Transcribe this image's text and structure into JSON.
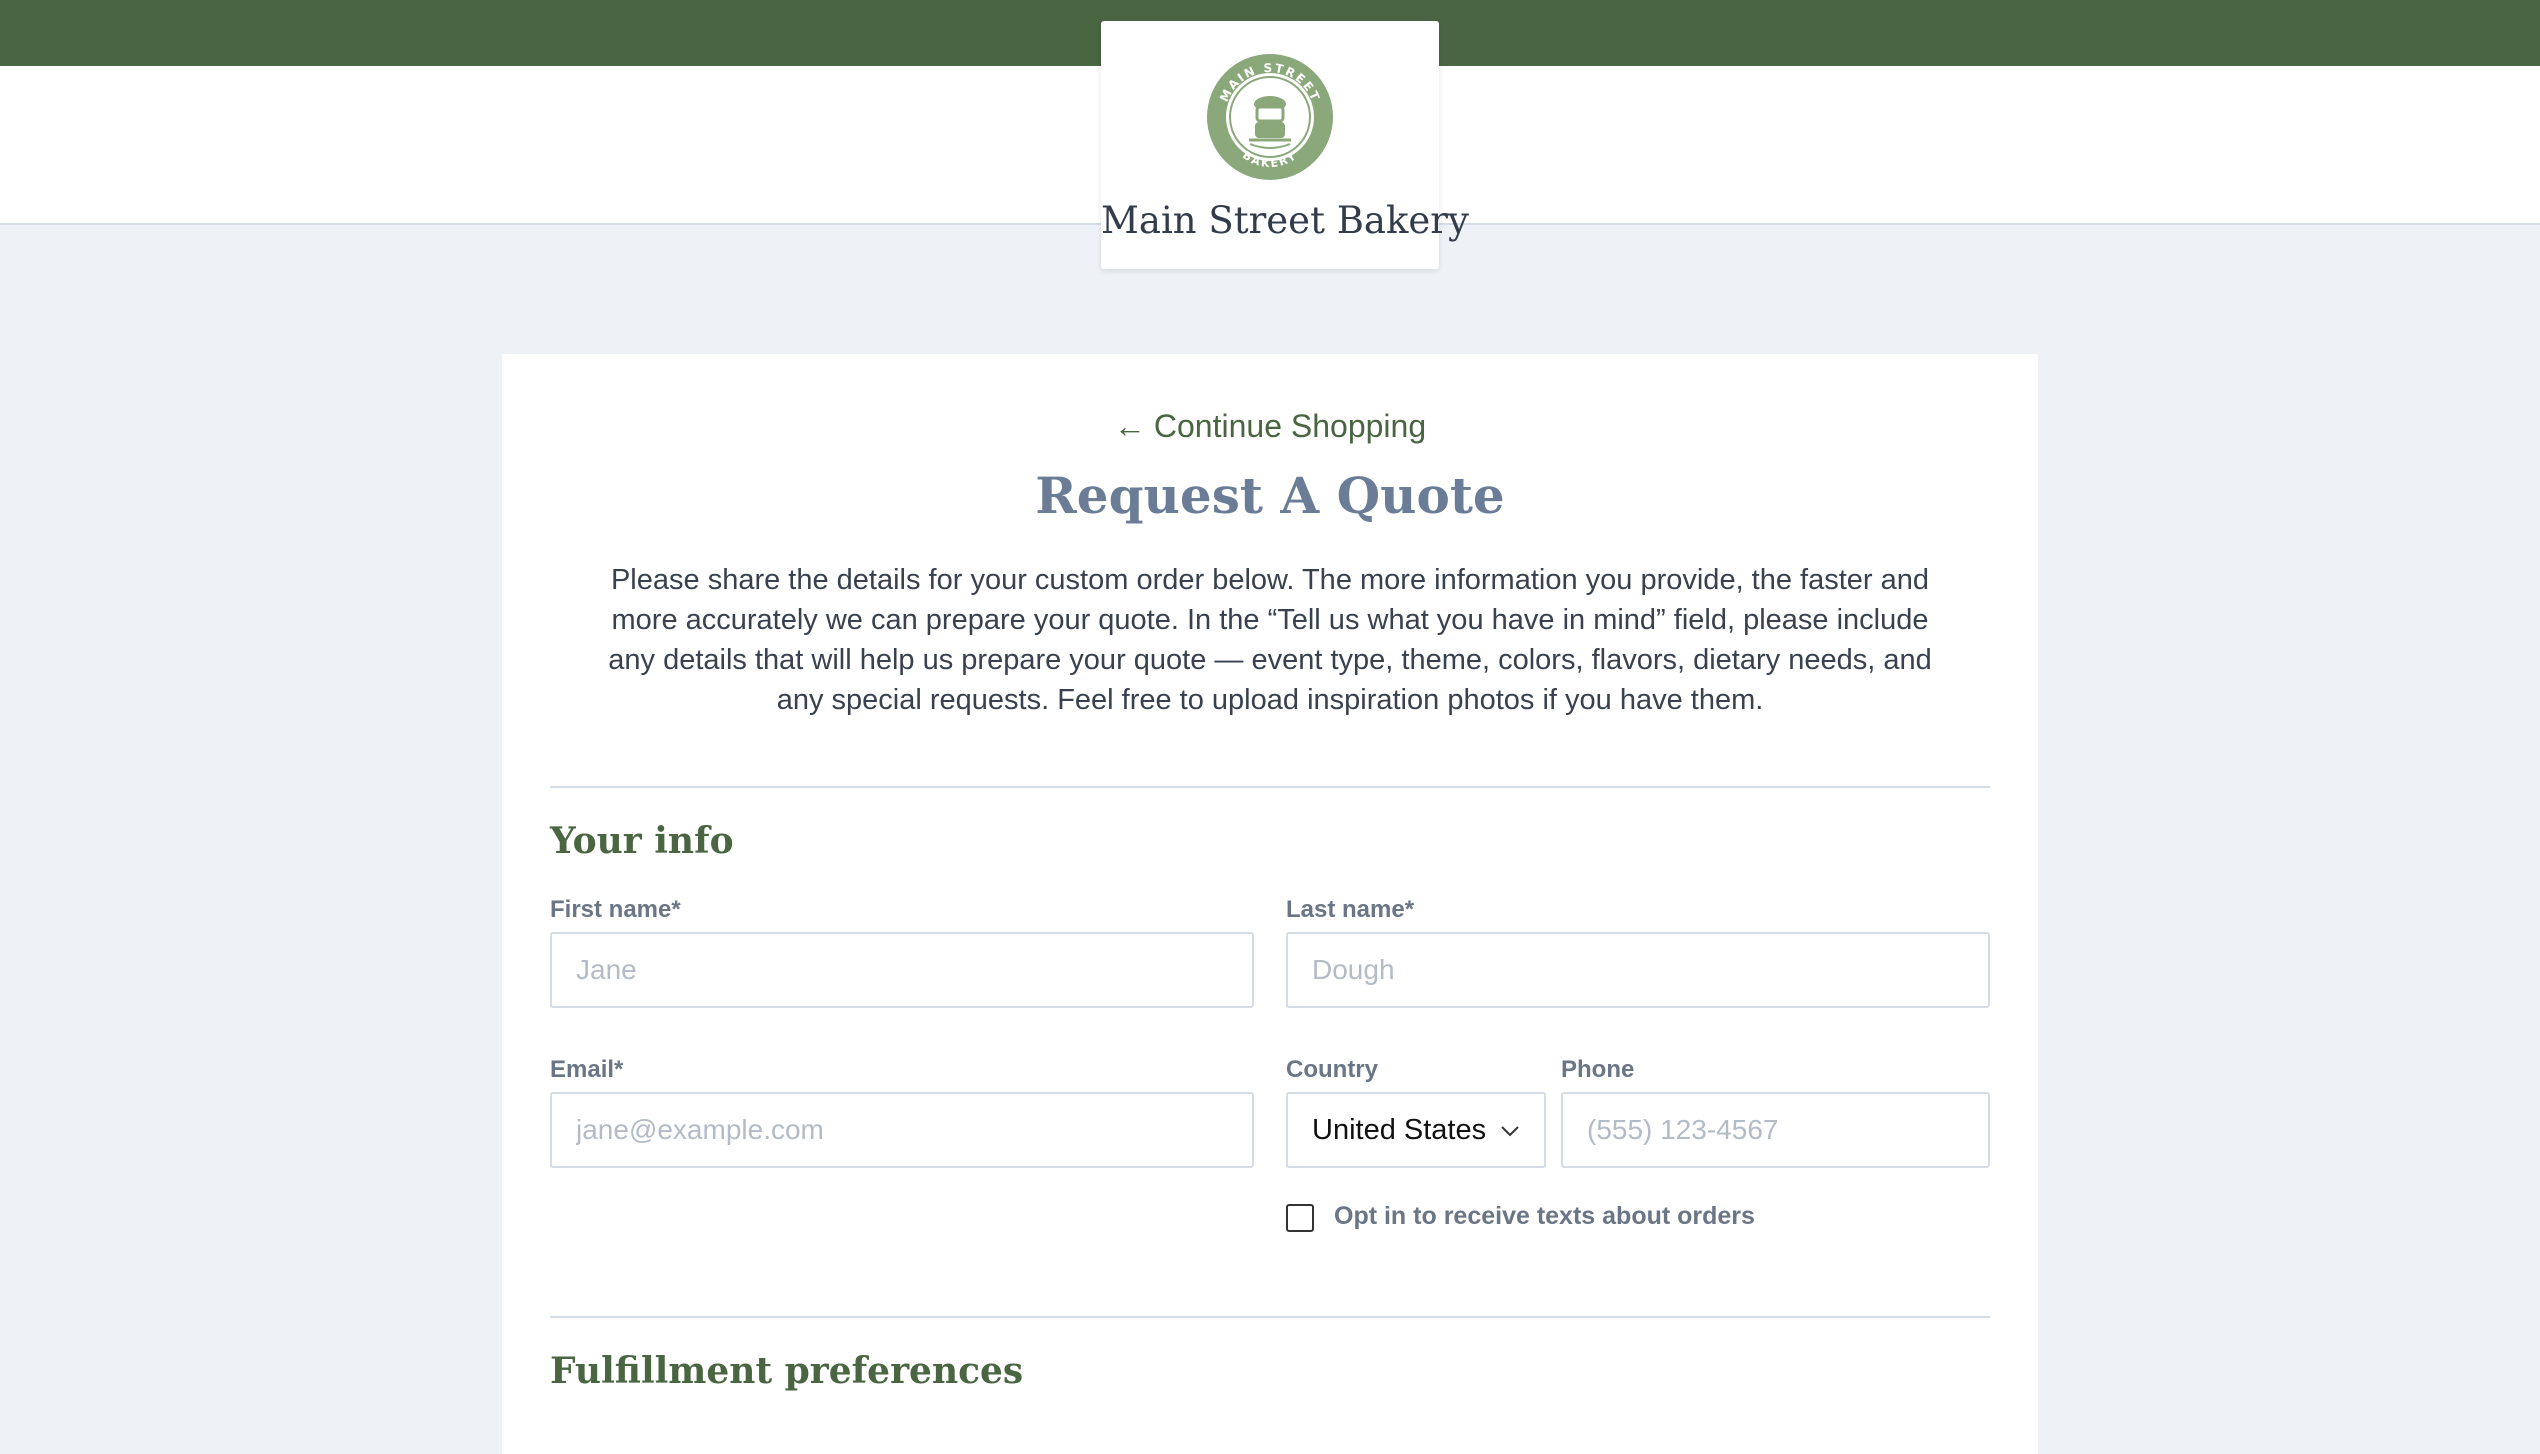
{
  "header": {
    "store_name": "Main Street Bakery",
    "logo_text_top": "MAIN STREET",
    "logo_text_bottom": "BAKERY",
    "colors": {
      "brand_green": "#4a6542",
      "seal_green": "#8ba87a"
    }
  },
  "nav": {
    "continue_label": "Continue Shopping",
    "continue_icon": "arrow-left-icon"
  },
  "page": {
    "title": "Request A Quote",
    "intro": "Please share the details for your custom order below. The more information you provide, the faster and more accurately we can prepare your quote. In the “Tell us what you have in mind” field, please include any details that will help us prepare your quote — event type, theme, colors, flavors, dietary needs, and any special requests. Feel free to upload inspiration photos if you have them."
  },
  "your_info": {
    "heading": "Your info",
    "first_name": {
      "label": "First name*",
      "placeholder": "Jane",
      "value": ""
    },
    "last_name": {
      "label": "Last name*",
      "placeholder": "Dough",
      "value": ""
    },
    "email": {
      "label": "Email*",
      "placeholder": "jane@example.com",
      "value": ""
    },
    "country": {
      "label": "Country",
      "selected": "United States",
      "icon": "chevron-down-icon"
    },
    "phone": {
      "label": "Phone",
      "placeholder": "(555) 123-4567",
      "value": ""
    },
    "sms_opt_in": {
      "label": "Opt in to receive texts about orders",
      "checked": false
    }
  },
  "fulfillment": {
    "heading": "Fulfillment preferences"
  }
}
